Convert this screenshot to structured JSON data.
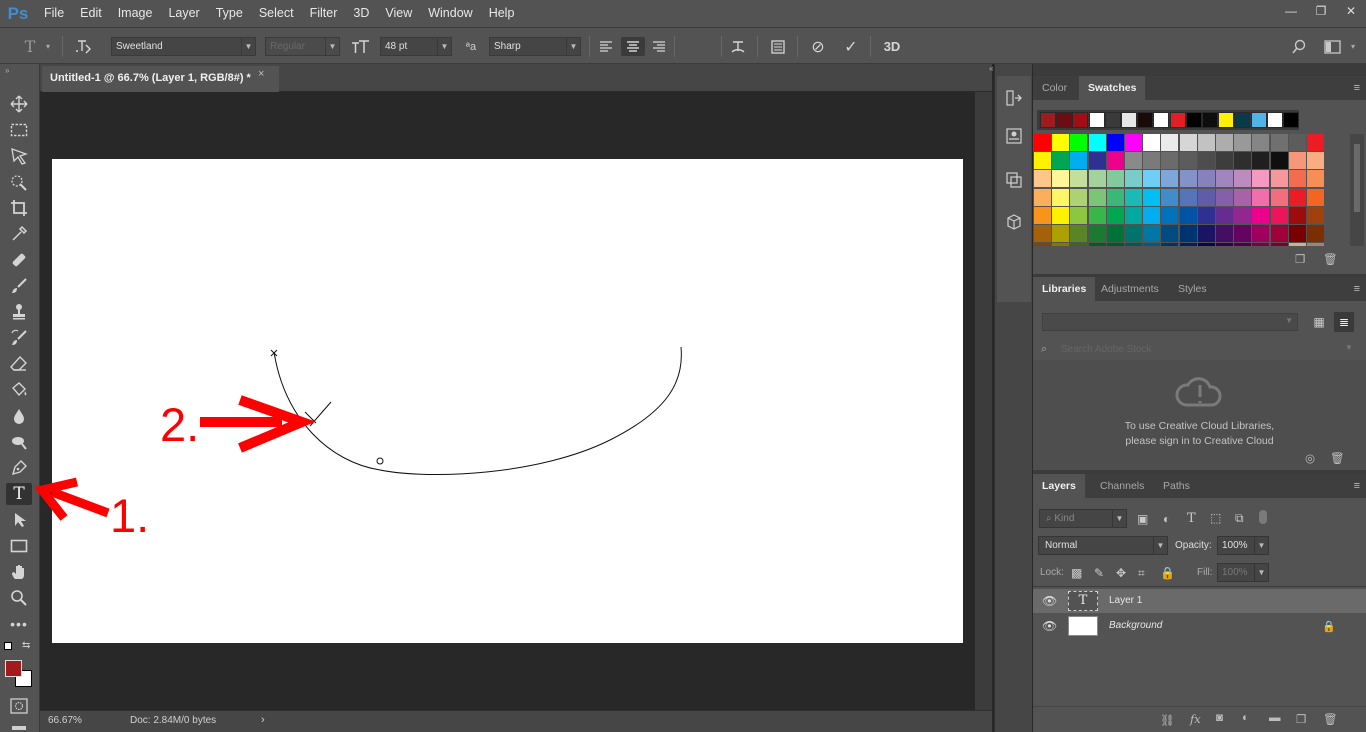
{
  "app": {
    "logo": "Ps"
  },
  "menu": [
    "File",
    "Edit",
    "Image",
    "Layer",
    "Type",
    "Select",
    "Filter",
    "3D",
    "View",
    "Window",
    "Help"
  ],
  "window_controls": {
    "minimize": "—",
    "restore": "❐",
    "close": "✕"
  },
  "options": {
    "font_family": "Sweetland",
    "font_style": "Regular",
    "font_size": "48 pt",
    "antialias": "Sharp",
    "text_color": "#a4191c",
    "three_d_label": "3D"
  },
  "document": {
    "tab_title": "Untitled-1 @ 66.7% (Layer 1, RGB/8#) *",
    "close": "×",
    "zoom": "66.67%",
    "doc_info": "Doc: 2.84M/0 bytes"
  },
  "annotations": {
    "label1": "1.",
    "label2": "2.",
    "color": "#ff0000"
  },
  "colors": {
    "foreground": "#a4191c",
    "background": "#ffffff"
  },
  "swatch_panel": {
    "tabs": [
      "Color",
      "Swatches"
    ],
    "active_tab": "Swatches",
    "recent": [
      "#9e1b1e",
      "#6d0c12",
      "#a10e14",
      "#ffffff",
      "#3a3a3a",
      "#e6e6e6",
      "#1a0a0a",
      "#ffffff",
      "#e41e26",
      "#000000",
      "#0d0d0d",
      "#fff200",
      "#083a4a",
      "#4fb5e6",
      "#ffffff",
      "#000000"
    ],
    "rows": [
      [
        "#ff0000",
        "#ffff00",
        "#00ff00",
        "#00ffff",
        "#0000ff",
        "#ff00ff",
        "#ffffff",
        "#ebebeb",
        "#d6d6d6",
        "#c2c2c2",
        "#adadad",
        "#999999",
        "#858585",
        "#707070",
        "#5c5c5c",
        "#ed1c24"
      ],
      [
        "#fff200",
        "#00a651",
        "#00aeef",
        "#2e3192",
        "#ec008c",
        "#8a8a8a",
        "#7a7a7a",
        "#6b6b6b",
        "#5c5c5c",
        "#4d4d4d",
        "#3d3d3d",
        "#2e2e2e",
        "#1f1f1f",
        "#0f0f0f",
        "#f7977a",
        "#f9ad81"
      ],
      [
        "#fdc68a",
        "#fff799",
        "#c4df9b",
        "#a3d39c",
        "#82ca9d",
        "#7accc8",
        "#6dcff6",
        "#7da7d9",
        "#8393ca",
        "#8781bd",
        "#a186be",
        "#bd8cbf",
        "#f49ac1",
        "#f5989d",
        "#f26c4f",
        "#f68e56"
      ],
      [
        "#fbaf5d",
        "#fff568",
        "#acd373",
        "#7cc576",
        "#3bb878",
        "#1abbb4",
        "#00bff3",
        "#438ccb",
        "#5574b9",
        "#605ca8",
        "#8560a8",
        "#a863a8",
        "#f06eaa",
        "#f26d7d",
        "#ed1c24",
        "#f26522"
      ],
      [
        "#f7941d",
        "#fff200",
        "#8dc73f",
        "#39b54a",
        "#00a651",
        "#00a99d",
        "#00aeef",
        "#0072bc",
        "#0054a6",
        "#2e3192",
        "#662d91",
        "#92278f",
        "#ec008c",
        "#ed145b",
        "#9e0b0f",
        "#a0410d"
      ],
      [
        "#a3620a",
        "#aba000",
        "#598527",
        "#1a7b30",
        "#007236",
        "#00746b",
        "#0076a3",
        "#004b80",
        "#003471",
        "#1b1464",
        "#440e62",
        "#630460",
        "#9e005d",
        "#9e0039",
        "#790000",
        "#7b2e00"
      ],
      [
        "#7d4900",
        "#827b00",
        "#406618",
        "#005e20",
        "#005826",
        "#005952",
        "#005b7f",
        "#003663",
        "#002157",
        "#0d004c",
        "#32004b",
        "#4b0049",
        "#7b0046",
        "#7a0026",
        "#c7b299",
        "#998675"
      ]
    ]
  },
  "libraries_panel": {
    "tabs": [
      "Libraries",
      "Adjustments",
      "Styles"
    ],
    "active_tab": "Libraries",
    "search_placeholder": "Search Adobe Stock",
    "message_line1": "To use Creative Cloud Libraries,",
    "message_line2": "please sign in to Creative Cloud"
  },
  "layers_panel": {
    "tabs": [
      "Layers",
      "Channels",
      "Paths"
    ],
    "active_tab": "Layers",
    "kind_label": "Kind",
    "blend_mode": "Normal",
    "opacity_label": "Opacity:",
    "opacity_value": "100%",
    "lock_label": "Lock:",
    "fill_label": "Fill:",
    "fill_value": "100%",
    "layers": [
      {
        "name": "Layer 1",
        "type": "text",
        "selected": true
      },
      {
        "name": "Background",
        "type": "image",
        "locked": true
      }
    ]
  }
}
